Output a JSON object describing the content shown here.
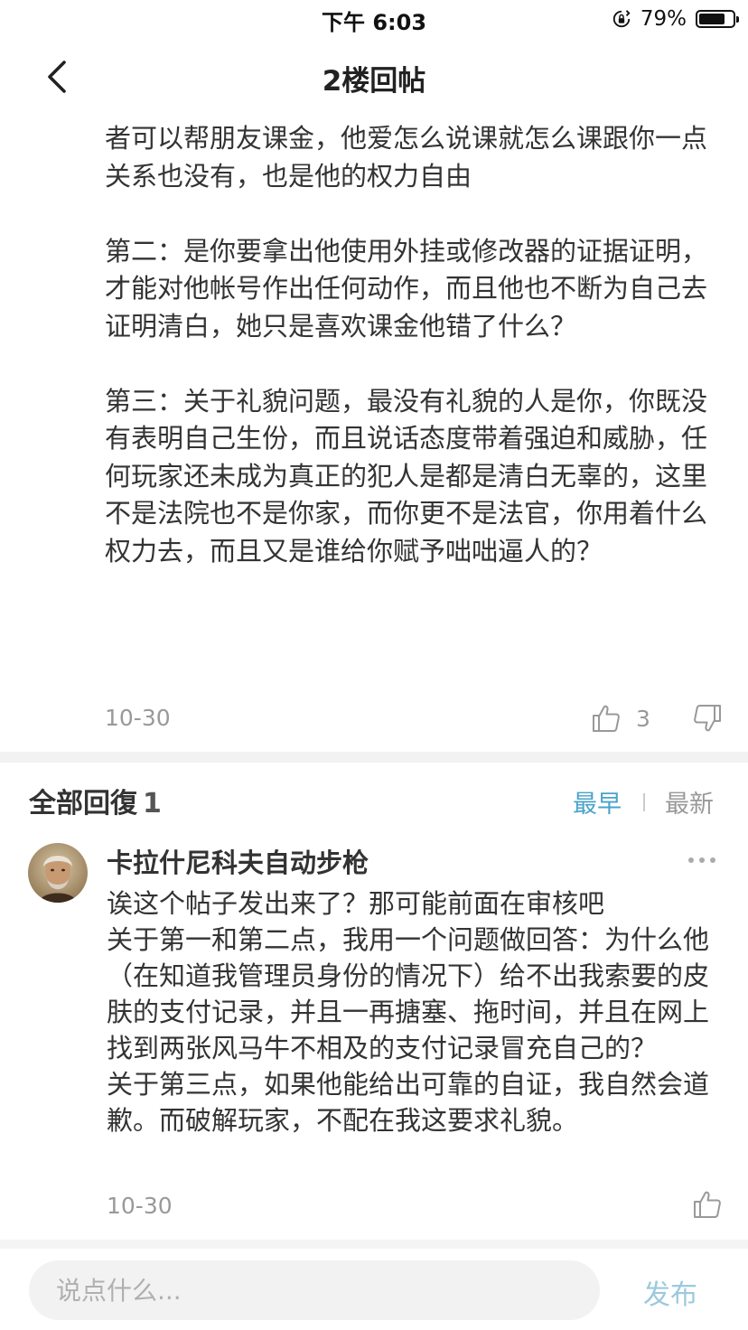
{
  "status_bar": {
    "time": "下午 6:03",
    "battery": "79%",
    "battery_level_percent": 79
  },
  "nav": {
    "title": "2楼回帖"
  },
  "post": {
    "paragraphs": [
      "者可以帮朋友课金，他爱怎么说课就怎么课跟你一点关系也没有，也是他的权力自由",
      "第二：是你要拿出他使用外挂或修改器的证据证明，才能对他帐号作出任何动作，而且他也不断为自己去证明清白，她只是喜欢课金他错了什么？",
      "第三：关于礼貌问题，最没有礼貌的人是你，你既没有表明自己生份，而且说话态度带着强迫和威胁，任何玩家还未成为真正的犯人是都是清白无辜的，这里不是法院也不是你家，而你更不是法官，你用着什么权力去，而且又是谁给你赋予咄咄逼人的？"
    ],
    "date": "10-30",
    "like_count": "3"
  },
  "replies": {
    "title": "全部回復",
    "count": "1",
    "sort_earliest": "最早",
    "sort_newest": "最新"
  },
  "comment": {
    "author": "卡拉什尼科夫自动步枪",
    "lines": [
      "诶这个帖子发出来了？那可能前面在审核吧",
      "关于第一和第二点，我用一个问题做回答：为什么他（在知道我管理员身份的情况下）给不出我索要的皮肤的支付记录，并且一再搪塞、拖时间，并且在网上找到两张风马牛不相及的支付记录冒充自己的？",
      "关于第三点，如果他能给出可靠的自证，我自然会道歉。而破解玩家，不配在我这要求礼貌。"
    ],
    "date": "10-30"
  },
  "input_bar": {
    "placeholder": "说点什么...",
    "publish_label": "发布"
  },
  "colors": {
    "accent": "#4aa3c8",
    "publish_disabled": "#9cc9de",
    "muted": "#999999"
  }
}
